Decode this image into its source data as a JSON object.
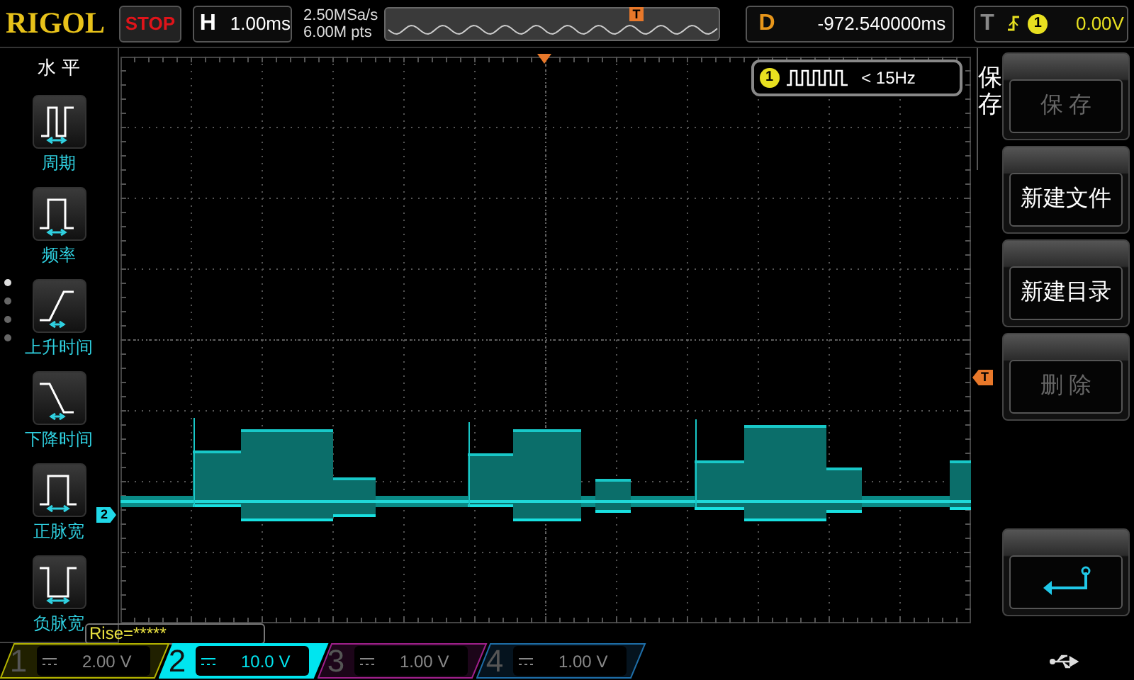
{
  "brand": "RIGOL",
  "run_state": "STOP",
  "horizontal": {
    "label": "H",
    "value": "1.00ms"
  },
  "sample_rate": "2.50MSa/s",
  "memory_depth": "6.00M pts",
  "memory_trigger_marker": "T",
  "delay": {
    "label": "D",
    "value": "-972.540000ms"
  },
  "trigger": {
    "label": "T",
    "channel": "1",
    "level": "0.00V"
  },
  "left_menu": {
    "title": "水 平",
    "items": [
      {
        "kind": "period",
        "label": "周期"
      },
      {
        "kind": "frequency",
        "label": "频率"
      },
      {
        "kind": "rise_time",
        "label": "上升时间"
      },
      {
        "kind": "fall_time",
        "label": "下降时间"
      },
      {
        "kind": "positive_width",
        "label": "正脉宽"
      },
      {
        "kind": "negative_width",
        "label": "负脉宽"
      }
    ],
    "pages": [
      {
        "selected": true
      },
      {
        "selected": false
      },
      {
        "selected": false
      },
      {
        "selected": false
      }
    ]
  },
  "counter": {
    "channel": "1",
    "reading": "< 15Hz"
  },
  "channel_marker": "2",
  "trigger_level_marker": "T",
  "measurement": "Rise=*****",
  "right_menu": {
    "title": "保存",
    "items": [
      {
        "kind": "text",
        "label": "保 存",
        "disabled": true
      },
      {
        "kind": "text",
        "label": "新建文件",
        "disabled": false
      },
      {
        "kind": "text",
        "label": "新建目录",
        "disabled": false
      },
      {
        "kind": "text",
        "label": "删 除",
        "disabled": true
      },
      {
        "kind": "back"
      }
    ]
  },
  "channels": [
    {
      "number": "1",
      "scale": "2.00 V",
      "selected": false,
      "color": "#b4b400"
    },
    {
      "number": "2",
      "scale": "10.0 V",
      "selected": true,
      "color": "#00e5ef"
    },
    {
      "number": "3",
      "scale": "1.00 V",
      "selected": false,
      "color": "#a0208c"
    },
    {
      "number": "4",
      "scale": "1.00 V",
      "selected": false,
      "color": "#1e6ea8"
    }
  ]
}
